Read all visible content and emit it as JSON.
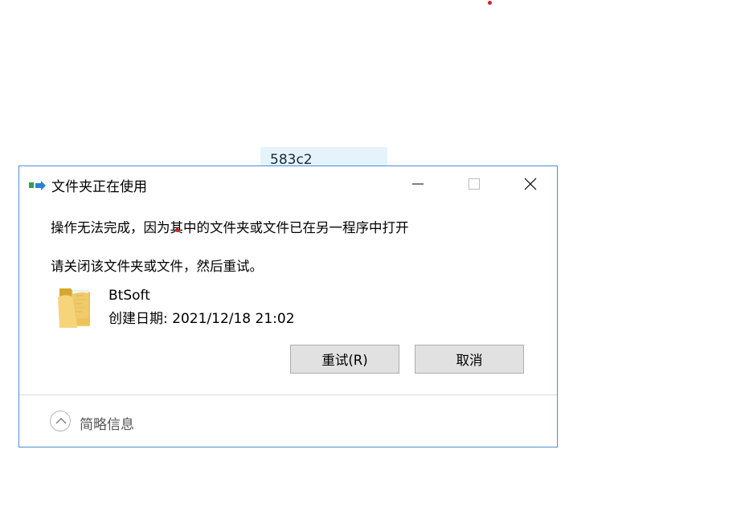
{
  "background_cell": {
    "text": "583c2"
  },
  "dialog": {
    "title": "文件夹正在使用",
    "message_line1": "操作无法完成，因为其中的文件夹或文件已在另一程序中打开",
    "message_line2": "请关闭该文件夹或文件，然后重试。",
    "file": {
      "name": "BtSoft",
      "created": "创建日期: 2021/12/18 21:02"
    },
    "buttons": {
      "retry": "重试(R)",
      "cancel": "取消"
    },
    "details_toggle": "简略信息"
  },
  "colors": {
    "dialog_border": "#4a90d9",
    "button_face": "#e1e1e1",
    "highlight_cell": "#e5f3fb"
  },
  "icons": [
    "app-icon",
    "minimize-icon",
    "maximize-icon",
    "close-icon",
    "folder-icon",
    "chevron-up-icon"
  ]
}
